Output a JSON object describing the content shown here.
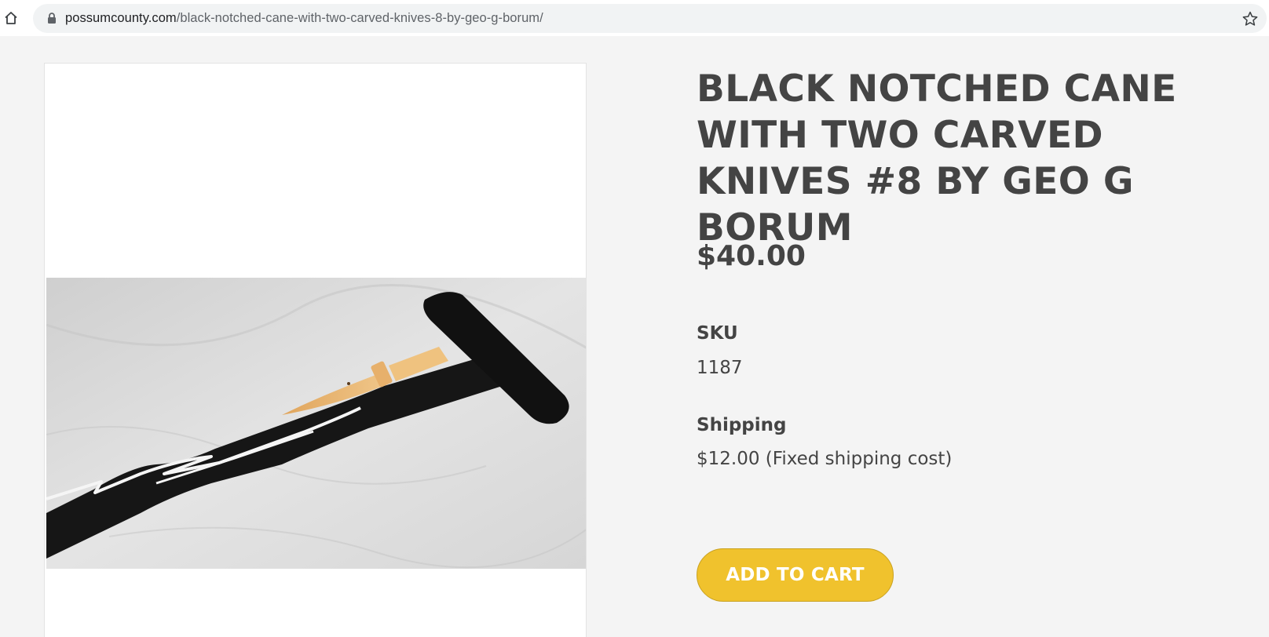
{
  "browser": {
    "url_domain": "possumcounty.com",
    "url_path": "/black-notched-cane-with-two-carved-knives-8-by-geo-g-borum/",
    "icons": {
      "home": "home-icon",
      "lock": "lock-icon",
      "bookmark": "star-icon"
    }
  },
  "product": {
    "title": "BLACK NOTCHED CANE WITH TWO CARVED KNIVES #8 BY GEO G BORUM",
    "price": "$40.00",
    "sku_label": "SKU",
    "sku_value": "1187",
    "shipping_label": "Shipping",
    "shipping_value": "$12.00 (Fixed shipping cost)",
    "add_to_cart_label": "ADD TO CART",
    "image_alt": "Black notched cane with carved wooden knife"
  },
  "colors": {
    "page_background": "#f4f4f4",
    "text": "#444444",
    "button": "#f0c22d",
    "button_text": "#ffffff"
  }
}
